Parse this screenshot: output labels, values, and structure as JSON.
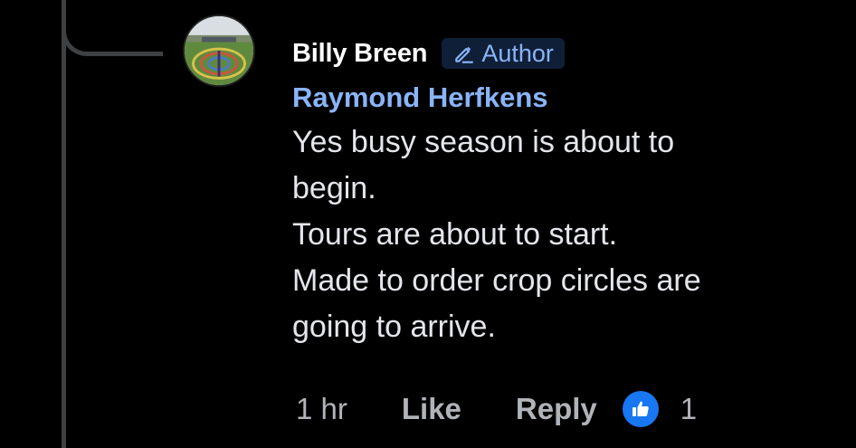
{
  "comment": {
    "author": "Billy Breen",
    "badge": "Author",
    "badge_icon": "pencil-icon",
    "mention": "Raymond Herfkens",
    "lines": [
      "Yes busy season is about to",
      "begin.",
      "Tours are about to start.",
      "Made to order crop circles are",
      "going to arrive."
    ]
  },
  "actions": {
    "timestamp": "1 hr",
    "like_label": "Like",
    "reply_label": "Reply",
    "reaction_icon": "thumbs-up-icon",
    "reaction_count": "1"
  },
  "colors": {
    "background": "#000000",
    "name": "#ffffff",
    "mention": "#8ab4f8",
    "badge_bg": "#0f1f38",
    "muted": "#b0b3b8",
    "reaction": "#1877f2"
  }
}
